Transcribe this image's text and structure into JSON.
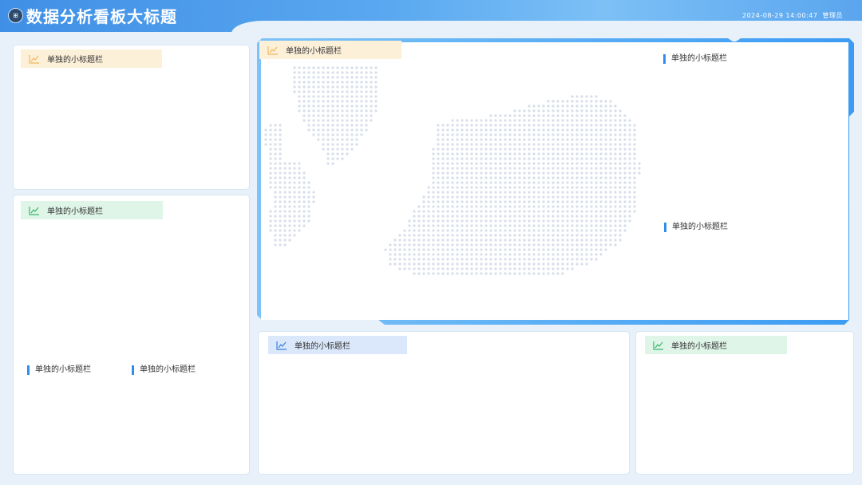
{
  "header": {
    "title": "数据分析看板大标题",
    "datetime": "2024-08-29 14:00:47",
    "user": "管理员",
    "logo_glyph": "⊞"
  },
  "panels": {
    "top_left": {
      "tag": "单独的小标题栏"
    },
    "mid_left": {
      "tag": "单独的小标题栏",
      "sub1": "单独的小标题栏",
      "sub2": "单独的小标题栏"
    },
    "map": {
      "tag": "单独的小标题栏",
      "sub_top": "单独的小标题栏",
      "sub_mid": "单独的小标题栏"
    },
    "bottom_mid": {
      "tag": "单独的小标题栏"
    },
    "bottom_right": {
      "tag": "单独的小标题栏"
    }
  },
  "colors": {
    "accent": "#2f8df0",
    "tag_orange": "#fdf0d9",
    "tag_green": "#dff5e8",
    "tag_blue": "#dbe8fb"
  },
  "icons": {
    "tag_icon": "line-chart-icon"
  }
}
